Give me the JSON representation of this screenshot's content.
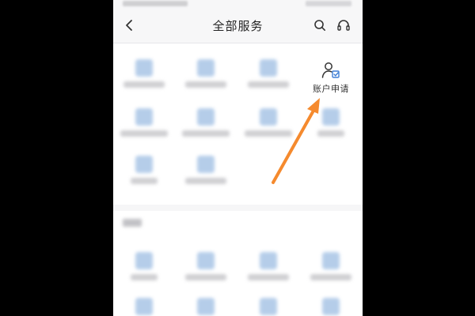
{
  "header": {
    "title": "全部服务"
  },
  "icons": {
    "back": "chevron-left-icon",
    "search": "search-icon",
    "support": "headset-icon",
    "account": "user-check-icon"
  },
  "services": {
    "account_application": {
      "label": "账户申请"
    }
  },
  "annotation": {
    "arrow_color": "#f58a2e"
  },
  "colors": {
    "icon_blue": "#3f7fd6",
    "text": "#222222",
    "background": "#000000"
  }
}
